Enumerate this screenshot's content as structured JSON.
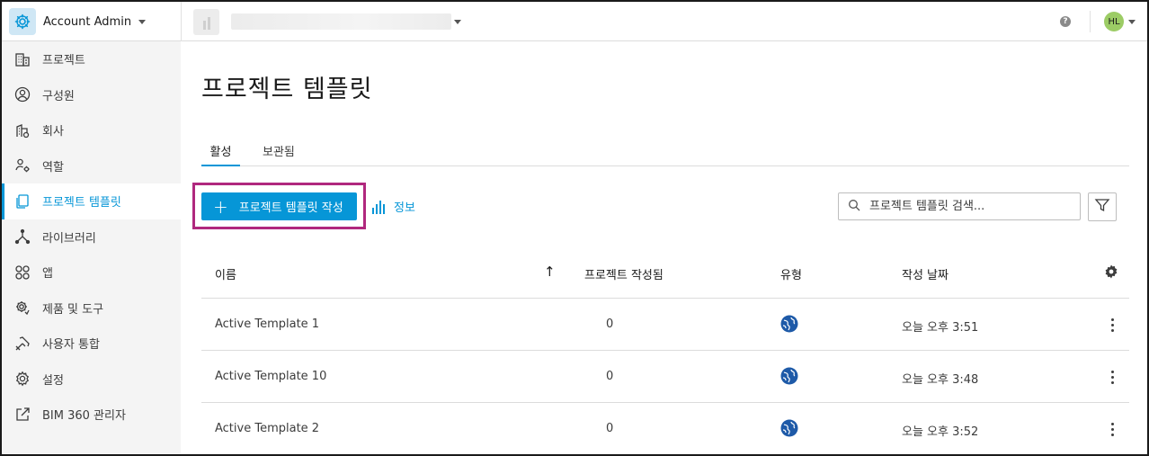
{
  "header": {
    "app_name": "Account Admin",
    "help_label": "?",
    "avatar_initials": "HL"
  },
  "sidebar": {
    "items": [
      {
        "label": "프로젝트",
        "icon": "building-icon"
      },
      {
        "label": "구성원",
        "icon": "user-circle-icon"
      },
      {
        "label": "회사",
        "icon": "company-icon"
      },
      {
        "label": "역할",
        "icon": "role-icon"
      },
      {
        "label": "프로젝트 템플릿",
        "icon": "template-icon",
        "active": true
      },
      {
        "label": "라이브러리",
        "icon": "library-icon"
      },
      {
        "label": "앱",
        "icon": "apps-icon"
      },
      {
        "label": "제품 및 도구",
        "icon": "products-gear-icon"
      },
      {
        "label": "사용자 통합",
        "icon": "integration-tools-icon"
      },
      {
        "label": "설정",
        "icon": "settings-icon"
      },
      {
        "label": "BIM 360 관리자",
        "icon": "external-link-icon"
      }
    ]
  },
  "main": {
    "title": "프로젝트 템플릿",
    "tabs": [
      {
        "label": "활성",
        "active": true
      },
      {
        "label": "보관됨",
        "active": false
      }
    ],
    "create_button": "프로젝트 템플릿 작성",
    "info_link": "정보",
    "search": {
      "placeholder": "프로젝트 템플릿 검색..."
    },
    "accent_color": "#0696d7",
    "highlight_color": "#b0287e"
  },
  "table": {
    "columns": {
      "name": "이름",
      "sort_indicator": "↑",
      "projects_created": "프로젝트 작성됨",
      "type": "유형",
      "created_date": "작성 날짜"
    },
    "rows": [
      {
        "name": "Active Template 1",
        "projects_created": "0",
        "type_icon": "globe-icon",
        "created_date": "오늘 오후 3:51"
      },
      {
        "name": "Active Template 10",
        "projects_created": "0",
        "type_icon": "globe-icon",
        "created_date": "오늘 오후 3:48"
      },
      {
        "name": "Active Template 2",
        "projects_created": "0",
        "type_icon": "globe-icon",
        "created_date": "오늘 오후 3:52"
      }
    ]
  }
}
